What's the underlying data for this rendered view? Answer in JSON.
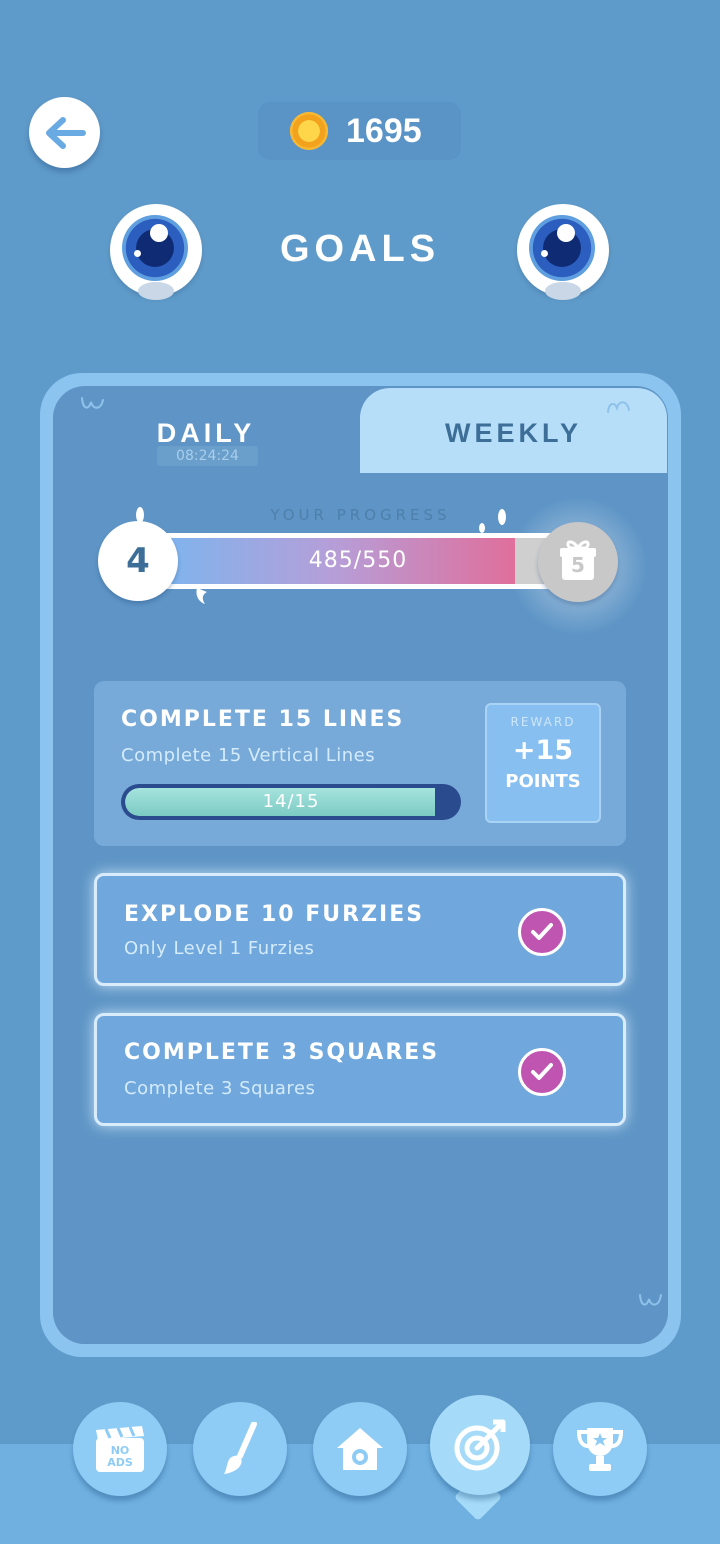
{
  "header": {
    "coins": "1695",
    "title": "GOALS"
  },
  "tabs": {
    "daily": {
      "label": "DAILY",
      "timer": "08:24:24"
    },
    "weekly": {
      "label": "WEEKLY"
    }
  },
  "progress": {
    "caption": "YOUR PROGRESS",
    "level": "4",
    "value_text": "485/550",
    "value": 485,
    "max": 550,
    "next_reward_level": "5"
  },
  "goals": [
    {
      "title": "COMPLETE 15 LINES",
      "subtitle": "Complete 15 Vertical Lines",
      "progress_text": "14/15",
      "progress": 14,
      "total": 15,
      "reward_label": "REWARD",
      "reward_points": "+15",
      "reward_unit": "POINTS",
      "completed": false
    },
    {
      "title": "EXPLODE 10 FURZIES",
      "subtitle": "Only Level 1 Furzies",
      "completed": true
    },
    {
      "title": "COMPLETE 3 SQUARES",
      "subtitle": "Complete 3 Squares",
      "completed": true
    }
  ],
  "nav": {
    "items": [
      {
        "icon": "no-ads-icon",
        "label_line1": "NO",
        "label_line2": "ADS"
      },
      {
        "icon": "paintbrush-icon"
      },
      {
        "icon": "home-icon"
      },
      {
        "icon": "target-icon",
        "active": true
      },
      {
        "icon": "trophy-icon"
      }
    ]
  },
  "colors": {
    "background": "#5f9bca",
    "panel_frame": "#8cc4f0",
    "panel_inner": "#5e95c6",
    "weekly_tab": "#b6def9",
    "checkmark": "#c054b1",
    "coin": "#f7b733"
  }
}
